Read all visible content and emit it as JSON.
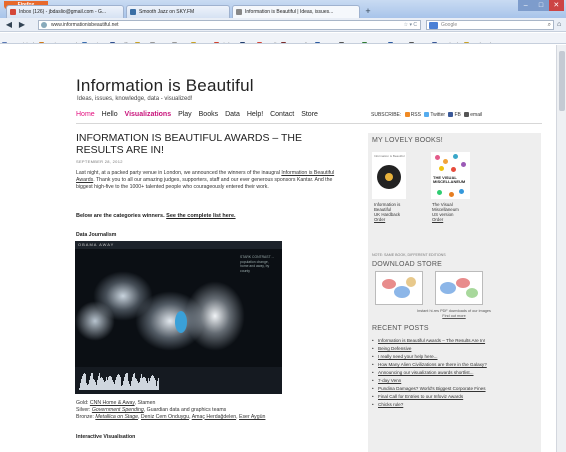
{
  "browser": {
    "app_button": "Firefox",
    "tabs": [
      {
        "label": "Inbox (126) - jbdaslio@gmail.com - G...",
        "favicon_color": "#d44638"
      },
      {
        "label": "Smooth Jazz on SKY.FM",
        "favicon_color": "#3a6ea5"
      },
      {
        "label": "Information is Beautiful | Ideas, issues...",
        "favicon_color": "#888888"
      }
    ],
    "new_tab_label": "+",
    "window_controls": {
      "minimize": "–",
      "maximize": "□",
      "close": "✕"
    },
    "back_label": "◀",
    "forward_label": "▶",
    "url": "www.informationisbeautiful.net",
    "url_actions": "☆ ▾ C",
    "search_placeholder": "Google",
    "search_icon": "⌕",
    "home_icon": "⌂",
    "bookmarks": [
      {
        "label": "Most Visited",
        "color": "#5b79b4"
      },
      {
        "label": "Getting Started",
        "color": "#d07a18"
      },
      {
        "label": "Marietta",
        "color": "#3c6fb0"
      },
      {
        "label": "Traffic",
        "color": "#2f4f8f"
      },
      {
        "label": "8",
        "color": "#c9a227"
      },
      {
        "label": "1331",
        "color": "#999999"
      },
      {
        "label": "480",
        "color": "#999999"
      },
      {
        "label": "7450",
        "color": "#c9a227"
      },
      {
        "label": "Zimbra",
        "color": "#d0422e"
      },
      {
        "label": "T2",
        "color": "#1f3d6e"
      },
      {
        "label": "Gmail",
        "color": "#d44638"
      },
      {
        "label": "JazzRadio",
        "color": "#7a2b2b"
      },
      {
        "label": "KPLU",
        "color": "#2c5aa0"
      },
      {
        "label": "KGW",
        "color": "#555555"
      },
      {
        "label": "Soccer",
        "color": "#2f7d32"
      },
      {
        "label": "BBs",
        "color": "#2c5aa0"
      },
      {
        "label": "Amgs",
        "color": "#555555"
      },
      {
        "label": "Facebook",
        "color": "#3b5998"
      },
      {
        "label": "Bookmarks",
        "color": "#c9a227"
      }
    ]
  },
  "site": {
    "title": "Information is Beautiful",
    "tagline": "Ideas, issues, knowledge, data - visualized!",
    "nav": [
      "Home",
      "Hello",
      "Visualizations",
      "Play",
      "Books",
      "Data",
      "Help!",
      "Contact",
      "Store"
    ],
    "subscribe": {
      "label": "SUBSCRIBE:",
      "rss": "RSS",
      "twitter": "Twitter",
      "fb": "FB",
      "email": "email"
    }
  },
  "post": {
    "title": "INFORMATION IS BEAUTIFUL AWARDS – THE RESULTS ARE IN!",
    "date": "SEPTEMBER 28, 2012",
    "body_1": "Last night, at a packed party venue in London, we announced the winners of the inaugral ",
    "body_link": "Information is Beautiful Awards",
    "body_2": ". Thank you to all our amazing judges, supporters, staff and our ever generous sponsors Kantar. And the biggest high-five to the 1000+ talented people who courageously entered their work.",
    "categories_text": "Below are the categories winners. ",
    "categories_link": "See the complete list here.",
    "section_1": "Data Journalism",
    "map_strip": "OBAMA     AWAY",
    "map_sideinfo": "STARK CONTRAST ... population change, home and away, by county",
    "gold_label": "Gold:",
    "gold_work": "CNN Home & Away",
    "gold_by": ", Stamen",
    "silver_label": "Silver:",
    "silver_work": "Government Spending",
    "silver_by": ", Guardian data and graphics teams",
    "bronze_label": "Bronze:",
    "bronze_work": "Metallica on Stage",
    "bronze_by_1": ", ",
    "bronze_names": "Deniz Cem Onduygu",
    "bronze_sep": ", ",
    "bronze_names_2": "Amaç Herdağdelen",
    "bronze_sep_2": ", ",
    "bronze_names_3": "Eser Aygün",
    "section_2": "Interactive Visualisation"
  },
  "sidebar": {
    "books_heading": "MY LOVELY BOOKS!",
    "book1_cover_title": "Information is Beautiful",
    "book1_caption_1": "Information is",
    "book1_caption_2": "Beautiful",
    "book1_caption_3": "UK Hardback",
    "book1_order": "Order",
    "book2_cover_title": "THE VISUAL MISCELLANEUM",
    "book2_caption_1": "The Visual",
    "book2_caption_2": "Miscellaneum",
    "book2_caption_3": "US version",
    "book2_order": "Order",
    "note": "NOTE: SAME BOOK, DIFFERENT EDITIONS",
    "store_heading": "DOWNLOAD STORE",
    "store_caption": "Instant hi-res PDF downloads of our images",
    "store_link": "Find out more",
    "recent_heading": "RECENT POSTS",
    "recent_posts": [
      "Information is Beautiful Awards – The Results Are In!",
      "Being Defensive",
      "I really need your help here...",
      "How Many Alien Civilizations are there in the Galaxy?",
      "Announcing our visualization awards shortlist...",
      "7-day Venn",
      "Pundina Damages? World's Biggest Corporate Fines",
      "Final Call for Entries to our Infoviz Awards",
      "Chicks rule?"
    ]
  }
}
